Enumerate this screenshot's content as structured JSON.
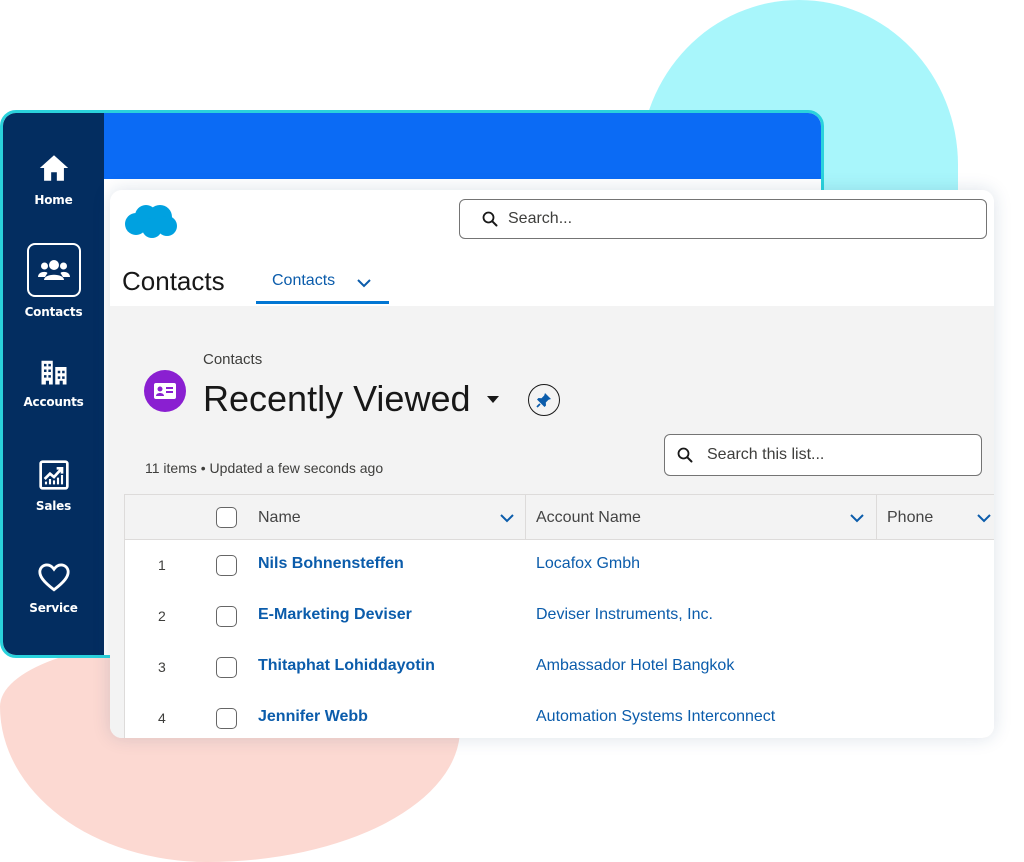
{
  "nav": {
    "items": [
      {
        "label": "Home"
      },
      {
        "label": "Contacts"
      },
      {
        "label": "Accounts"
      },
      {
        "label": "Sales"
      },
      {
        "label": "Service"
      }
    ]
  },
  "header": {
    "search_placeholder": "Search...",
    "app_title": "Contacts",
    "tab_label": "Contacts"
  },
  "list": {
    "object_label": "Contacts",
    "title": "Recently Viewed",
    "meta": "11 items • Updated a few seconds ago",
    "search_placeholder": "Search this list..."
  },
  "table": {
    "columns": [
      "Name",
      "Account Name",
      "Phone"
    ],
    "rows": [
      {
        "num": "1",
        "name": "Nils Bohnensteffen",
        "account": "Locafox Gmbh"
      },
      {
        "num": "2",
        "name": "E-Marketing Deviser",
        "account": "Deviser Instruments, Inc."
      },
      {
        "num": "3",
        "name": "Thitaphat Lohiddayotin",
        "account": "Ambassador Hotel Bangkok"
      },
      {
        "num": "4",
        "name": "Jennifer Webb",
        "account": "Automation Systems Interconnect"
      }
    ]
  },
  "colors": {
    "rail": "#032d60",
    "accent": "#0b6bf5",
    "link": "#0b5cab",
    "contact_icon": "#8a1fd1",
    "shell_border": "#2ad2dc",
    "blob_cyan": "#a8f6fb",
    "blob_peach": "#fcd9d2"
  },
  "icons": [
    "home-icon",
    "contacts-icon",
    "accounts-icon",
    "sales-icon",
    "service-icon",
    "salesforce-logo",
    "search-icon",
    "chevron-down-icon",
    "contact-card-icon",
    "caret-down-icon",
    "pin-icon"
  ]
}
